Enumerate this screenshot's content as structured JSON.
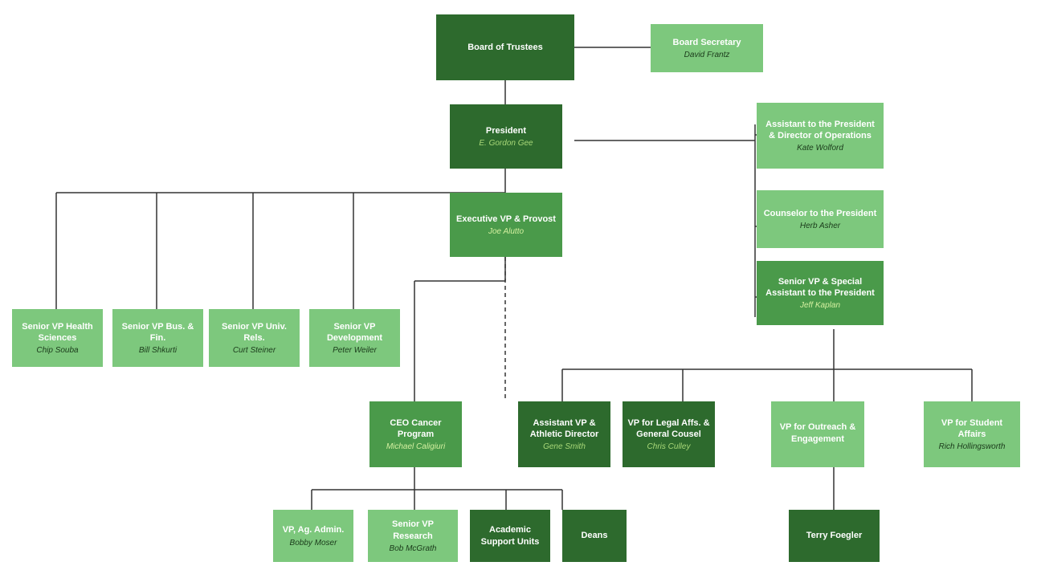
{
  "boxes": {
    "board": {
      "title": "Board of Trustees",
      "name": ""
    },
    "boardSecretary": {
      "title": "Board Secretary",
      "name": "David Frantz"
    },
    "president": {
      "title": "President",
      "name": "E. Gordon Gee"
    },
    "assistantPresident": {
      "title": "Assistant to the President & Director of Operations",
      "name": "Kate Wolford"
    },
    "counselor": {
      "title": "Counselor to the President",
      "name": "Herb Asher"
    },
    "seniorVPSpecial": {
      "title": "Senior VP & Special Assistant to the President",
      "name": "Jeff Kaplan"
    },
    "execVP": {
      "title": "Executive VP & Provost",
      "name": "Joe Alutto"
    },
    "seniorVPHealth": {
      "title": "Senior VP Health Sciences",
      "name": "Chip Souba"
    },
    "seniorVPBus": {
      "title": "Senior VP Bus. & Fin.",
      "name": "Bill Shkurti"
    },
    "seniorVPUniv": {
      "title": "Senior VP Univ. Rels.",
      "name": "Curt Steiner"
    },
    "seniorVPDev": {
      "title": "Senior VP Development",
      "name": "Peter Weiler"
    },
    "ceoCancer": {
      "title": "CEO Cancer Program",
      "name": "Michael Caligiuri"
    },
    "assistantVP": {
      "title": "Assistant VP & Athletic Director",
      "name": "Gene Smith"
    },
    "vpLegal": {
      "title": "VP for Legal Affs. & General Cousel",
      "name": "Chris Culley"
    },
    "vpOutreach": {
      "title": "VP for Outreach & Engagement",
      "name": ""
    },
    "vpStudent": {
      "title": "VP for Student Affairs",
      "name": "Rich Hollingsworth"
    },
    "vpAg": {
      "title": "VP, Ag. Admin.",
      "name": "Bobby Moser"
    },
    "seniorVPResearch": {
      "title": "Senior VP Research",
      "name": "Bob McGrath"
    },
    "academicSupport": {
      "title": "Academic Support Units",
      "name": ""
    },
    "deans": {
      "title": "Deans",
      "name": ""
    },
    "terryFoegler": {
      "title": "Terry Foegler",
      "name": ""
    }
  }
}
